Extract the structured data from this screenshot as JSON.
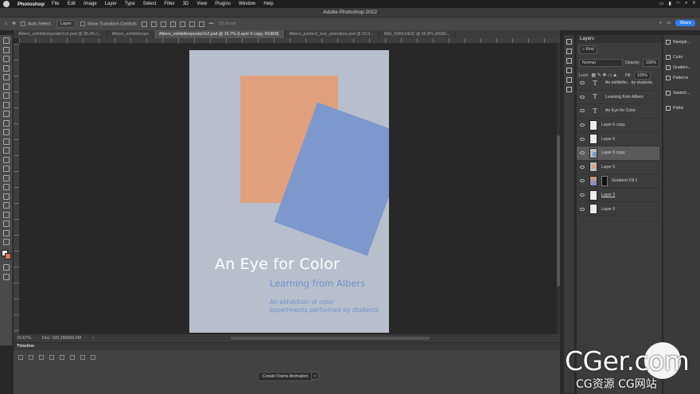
{
  "menubar": {
    "app": "Photoshop",
    "items": [
      "File",
      "Edit",
      "Image",
      "Layer",
      "Type",
      "Select",
      "Filter",
      "3D",
      "View",
      "Plugins",
      "Window",
      "Help"
    ]
  },
  "window": {
    "title": "Adobe Photoshop 2022"
  },
  "options": {
    "auto_select_label": "Auto-Select:",
    "auto_select_value": "Layer",
    "transform_controls": "Show Transform Controls",
    "mode_3d": "3D Mode:",
    "share": "Share"
  },
  "tabs": [
    {
      "label": "Albers_exhibitionposter1v2.psd @ 35.3% (...",
      "active": false
    },
    {
      "label": "Albers_exhibitionpo",
      "active": false
    },
    {
      "label": "Albers_exhibitionposter2v2.psd @ 16.7% (Layer 5 copy, RGB/8)",
      "active": true
    },
    {
      "label": "Albers_poster2_test_animation.psd @ 33.3...",
      "active": false
    },
    {
      "label": "IMG_6059.HEIC @ 65.8% (RGB/...",
      "active": false
    }
  ],
  "poster": {
    "title": "An Eye for Color",
    "subtitle": "Learning from Albers",
    "body_line1": "An exhibition of color",
    "body_line2": "experiments performed by students"
  },
  "status": {
    "zoom": "16.67%",
    "doc": "Doc: 199.2M/899.0M"
  },
  "timeline": {
    "title": "Timeline",
    "create_button": "Create Frame Animation"
  },
  "layers_panel": {
    "title": "Layers",
    "kind": "Kind",
    "blend_mode": "Normal",
    "opacity_label": "Opacity:",
    "opacity_value": "100%",
    "lock_label": "Lock:",
    "fill_label": "Fill:",
    "fill_value": "100%",
    "layers": [
      {
        "name": "An exhibitio... by students",
        "type": "text",
        "selected": false
      },
      {
        "name": "Learning from Albers",
        "type": "text",
        "selected": false
      },
      {
        "name": "An Eye for Color",
        "type": "text",
        "selected": false
      },
      {
        "name": "Layer 6 copy",
        "type": "pixel",
        "thumb": "wh",
        "selected": false
      },
      {
        "name": "Layer 6",
        "type": "pixel",
        "thumb": "wh",
        "selected": false
      },
      {
        "name": "Layer 5 copy",
        "type": "pixel",
        "thumb": "bl",
        "selected": true
      },
      {
        "name": "Layer 5",
        "type": "pixel",
        "thumb": "or",
        "selected": false
      },
      {
        "name": "Gradient Fill 1",
        "type": "fill",
        "thumb": "gr",
        "selected": false
      },
      {
        "name": "Layer 3",
        "type": "pixel",
        "thumb": "wh",
        "selected": false
      },
      {
        "name": "Layer 0",
        "type": "pixel",
        "thumb": "wh",
        "selected": false
      }
    ]
  },
  "mini_panels": {
    "group1": [
      "Navigat..."
    ],
    "group2": [
      "Color",
      "Gradien...",
      "Patterns"
    ],
    "group3": [
      "Swatch..."
    ],
    "group4": [
      "Paths"
    ]
  },
  "watermark": {
    "big": "CGer.com",
    "small": "CG资源 CG网站"
  },
  "colors": {
    "poster_bg": "#b8bfcc",
    "orange": "#e0a07e",
    "blue": "#7d98cc",
    "accent": "#2d7ef2"
  }
}
